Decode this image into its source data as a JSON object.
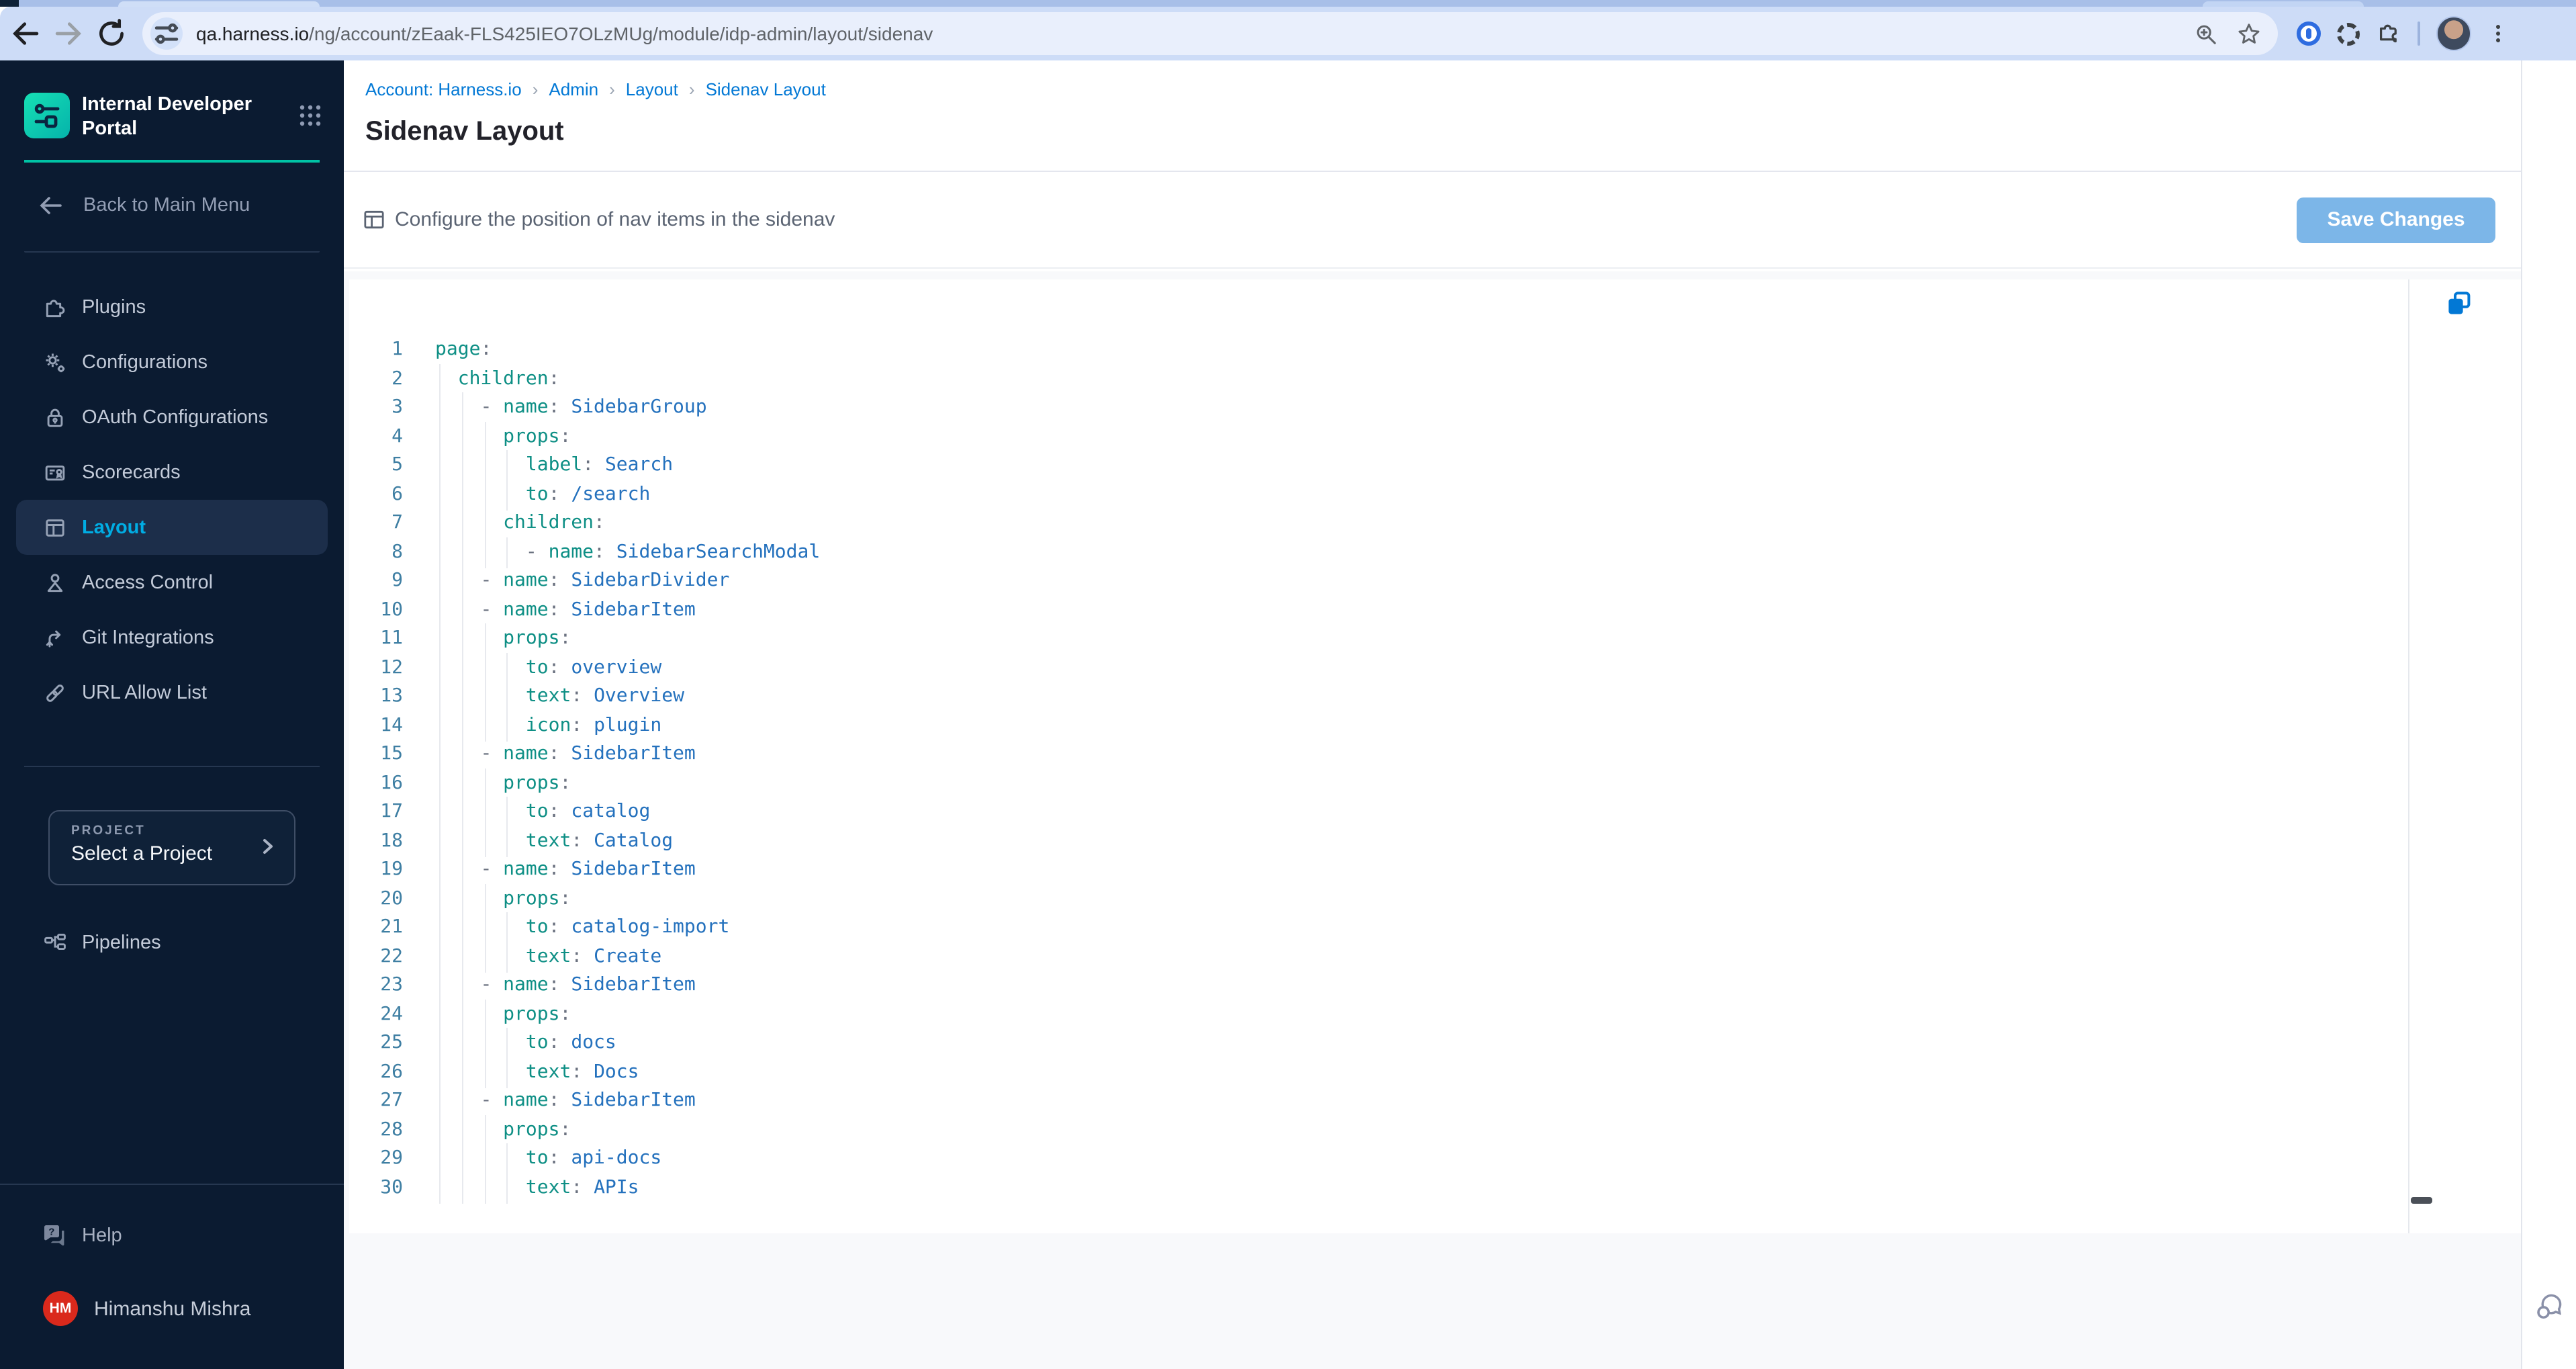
{
  "browser": {
    "url_domain": "qa.harness.io",
    "url_path": "/ng/account/zEaak-FLS425IEO7OLzMUg/module/idp-admin/layout/sidenav",
    "toolbar_icons": [
      "back-icon",
      "forward-icon",
      "reload-icon",
      "tune-icon",
      "zoom-in-icon",
      "bookmark-star-icon",
      "onepassword-icon",
      "burst-icon",
      "extensions-puzzle-icon",
      "profile-avatar",
      "menu-kebab-icon"
    ]
  },
  "sidebar": {
    "product_title": "Internal Developer Portal",
    "apps_grid_icon": "apps-grid-icon",
    "back_link": "Back to Main Menu",
    "nav_items": [
      {
        "label": "Plugins",
        "icon": "puzzle-icon",
        "active": false
      },
      {
        "label": "Configurations",
        "icon": "gears-icon",
        "active": false
      },
      {
        "label": "OAuth Configurations",
        "icon": "lock-icon",
        "active": false
      },
      {
        "label": "Scorecards",
        "icon": "scorecard-icon",
        "active": false
      },
      {
        "label": "Layout",
        "icon": "layout-icon",
        "active": true
      },
      {
        "label": "Access Control",
        "icon": "person-icon",
        "active": false
      },
      {
        "label": "Git Integrations",
        "icon": "git-branch-icon",
        "active": false
      },
      {
        "label": "URL Allow List",
        "icon": "link-icon",
        "active": false
      }
    ],
    "project_card": {
      "label": "PROJECT",
      "value": "Select a Project"
    },
    "secondary_nav": [
      {
        "label": "Pipelines",
        "icon": "pipeline-icon"
      }
    ],
    "footer": {
      "help_label": "Help",
      "user_name": "Himanshu Mishra",
      "avatar_initials": "HM"
    }
  },
  "main": {
    "breadcrumb": [
      "Account: Harness.io",
      "Admin",
      "Layout",
      "Sidenav Layout"
    ],
    "page_title": "Sidenav Layout",
    "action_bar": {
      "description": "Configure the position of nav items in the sidenav",
      "save_button": "Save Changes"
    },
    "editor": {
      "copy_icon": "copy-icon",
      "lines": [
        {
          "n": 1,
          "sp": 0,
          "dash": false,
          "k": "page",
          "v": ""
        },
        {
          "n": 2,
          "sp": 2,
          "dash": false,
          "k": "children",
          "v": ""
        },
        {
          "n": 3,
          "sp": 4,
          "dash": true,
          "k": "name",
          "v": "SidebarGroup"
        },
        {
          "n": 4,
          "sp": 6,
          "dash": false,
          "k": "props",
          "v": ""
        },
        {
          "n": 5,
          "sp": 8,
          "dash": false,
          "k": "label",
          "v": "Search"
        },
        {
          "n": 6,
          "sp": 8,
          "dash": false,
          "k": "to",
          "v": "/search"
        },
        {
          "n": 7,
          "sp": 6,
          "dash": false,
          "k": "children",
          "v": ""
        },
        {
          "n": 8,
          "sp": 8,
          "dash": true,
          "k": "name",
          "v": "SidebarSearchModal"
        },
        {
          "n": 9,
          "sp": 4,
          "dash": true,
          "k": "name",
          "v": "SidebarDivider"
        },
        {
          "n": 10,
          "sp": 4,
          "dash": true,
          "k": "name",
          "v": "SidebarItem"
        },
        {
          "n": 11,
          "sp": 6,
          "dash": false,
          "k": "props",
          "v": ""
        },
        {
          "n": 12,
          "sp": 8,
          "dash": false,
          "k": "to",
          "v": "overview"
        },
        {
          "n": 13,
          "sp": 8,
          "dash": false,
          "k": "text",
          "v": "Overview"
        },
        {
          "n": 14,
          "sp": 8,
          "dash": false,
          "k": "icon",
          "v": "plugin"
        },
        {
          "n": 15,
          "sp": 4,
          "dash": true,
          "k": "name",
          "v": "SidebarItem"
        },
        {
          "n": 16,
          "sp": 6,
          "dash": false,
          "k": "props",
          "v": ""
        },
        {
          "n": 17,
          "sp": 8,
          "dash": false,
          "k": "to",
          "v": "catalog"
        },
        {
          "n": 18,
          "sp": 8,
          "dash": false,
          "k": "text",
          "v": "Catalog"
        },
        {
          "n": 19,
          "sp": 4,
          "dash": true,
          "k": "name",
          "v": "SidebarItem"
        },
        {
          "n": 20,
          "sp": 6,
          "dash": false,
          "k": "props",
          "v": ""
        },
        {
          "n": 21,
          "sp": 8,
          "dash": false,
          "k": "to",
          "v": "catalog-import"
        },
        {
          "n": 22,
          "sp": 8,
          "dash": false,
          "k": "text",
          "v": "Create"
        },
        {
          "n": 23,
          "sp": 4,
          "dash": true,
          "k": "name",
          "v": "SidebarItem"
        },
        {
          "n": 24,
          "sp": 6,
          "dash": false,
          "k": "props",
          "v": ""
        },
        {
          "n": 25,
          "sp": 8,
          "dash": false,
          "k": "to",
          "v": "docs"
        },
        {
          "n": 26,
          "sp": 8,
          "dash": false,
          "k": "text",
          "v": "Docs"
        },
        {
          "n": 27,
          "sp": 4,
          "dash": true,
          "k": "name",
          "v": "SidebarItem"
        },
        {
          "n": 28,
          "sp": 6,
          "dash": false,
          "k": "props",
          "v": ""
        },
        {
          "n": 29,
          "sp": 8,
          "dash": false,
          "k": "to",
          "v": "api-docs"
        },
        {
          "n": 30,
          "sp": 8,
          "dash": false,
          "k": "text",
          "v": "APIs"
        }
      ]
    },
    "floating_chat_icon": "chat-bubbles-icon"
  },
  "colors": {
    "accent_cyan": "#00ade4",
    "brand_teal": "#00c3a5",
    "link_blue": "#0278d5",
    "save_button_blue": "#7cb6e8",
    "avatar_red": "#da291c",
    "sidebar_bg": "#0b1b31",
    "code_key": "#0e8f85",
    "code_value": "#2471bd",
    "code_line_number": "#3f7fa3"
  }
}
